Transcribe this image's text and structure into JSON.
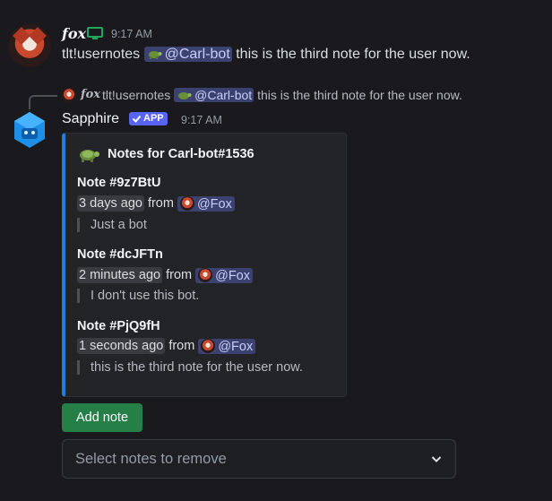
{
  "message1": {
    "author": "fox",
    "timestamp": "9:17 AM",
    "command": "tlt!usernotes",
    "mention": "@Carl-bot",
    "text": "this is the third note for the user now."
  },
  "reply": {
    "author": "fox",
    "command": "tlt!usernotes",
    "mention": "@Carl-bot",
    "text": "this is the third note for the user now."
  },
  "message2": {
    "author": "Sapphire",
    "badge": "APP",
    "timestamp": "9:17 AM"
  },
  "embed": {
    "title": "Notes for Carl-bot#1536",
    "accent_color": "#1e7fd8",
    "notes": [
      {
        "title": "Note #9z7BtU",
        "time": "3 days ago",
        "from": "from",
        "author": "@Fox",
        "body": "Just a bot"
      },
      {
        "title": "Note #dcJFTn",
        "time": "2 minutes ago",
        "from": "from",
        "author": "@Fox",
        "body": "I don't use this bot."
      },
      {
        "title": "Note #PjQ9fH",
        "time": "1 seconds ago",
        "from": "from",
        "author": "@Fox",
        "body": "this is the third note for the user now."
      }
    ]
  },
  "actions": {
    "add_label": "Add note",
    "select_placeholder": "Select notes to remove"
  },
  "icons": {
    "monitor": "monitor-icon",
    "turtle": "turtle-icon",
    "check": "check-icon",
    "chevron": "chevron-down-icon"
  },
  "colors": {
    "background": "#1a1a1e",
    "mention_bg": "#3c4270",
    "app_badge": "#5865f2",
    "add_button": "#248046"
  }
}
